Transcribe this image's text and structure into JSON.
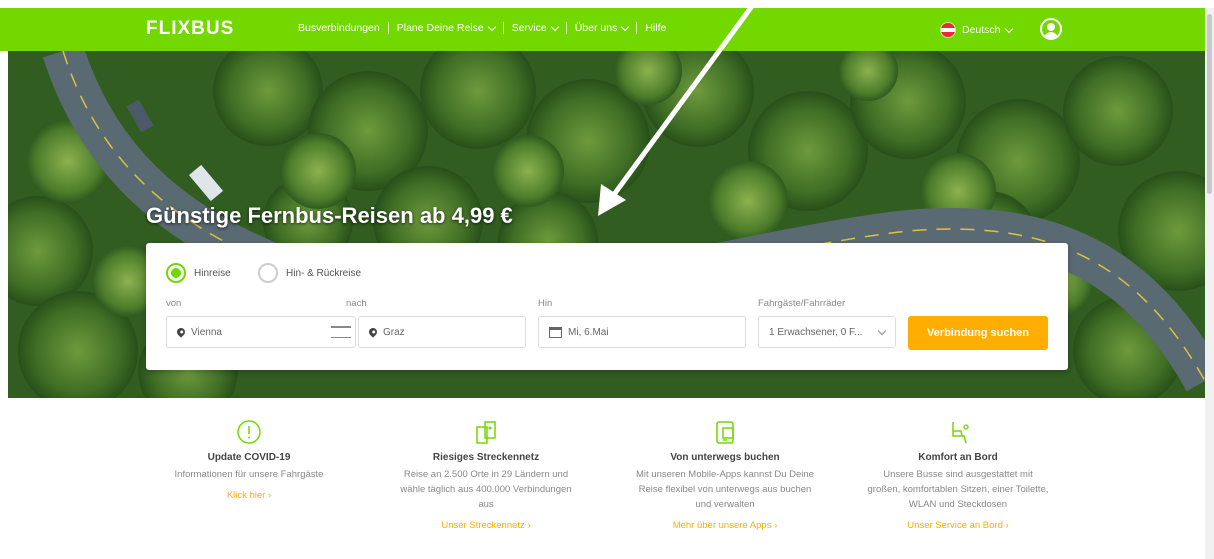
{
  "header": {
    "logo": "FLIXBUS",
    "nav": [
      {
        "label": "Busverbindungen",
        "has_dropdown": false
      },
      {
        "label": "Plane Deine Reise",
        "has_dropdown": true
      },
      {
        "label": "Service",
        "has_dropdown": true
      },
      {
        "label": "Über uns",
        "has_dropdown": true
      },
      {
        "label": "Hilfe",
        "has_dropdown": false
      }
    ],
    "language": "Deutsch"
  },
  "hero": {
    "headline": "Günstige Fernbus-Reisen ab 4,99 €"
  },
  "search": {
    "trip_types": [
      {
        "label": "Hinreise",
        "selected": true
      },
      {
        "label": "Hin- & Rückreise",
        "selected": false
      }
    ],
    "from_label": "von",
    "from_value": "Vienna",
    "to_label": "nach",
    "to_value": "Graz",
    "date_label": "Hin",
    "date_value": "Mi, 6.Mai",
    "passengers_label": "Fahrgäste/Fahrräder",
    "passengers_value": "1 Erwachsener, 0 F...",
    "submit_label": "Verbindung suchen"
  },
  "features": [
    {
      "icon": "info-circle-icon",
      "title": "Update COVID-19",
      "desc": "Informationen für unsere Fahrgäste",
      "link": "Klick hier"
    },
    {
      "icon": "route-network-icon",
      "title": "Riesiges Streckennetz",
      "desc": "Reise an 2.500 Orte in 29 Ländern und wähle täglich aus 400.000 Verbindungen aus",
      "link": "Unser Streckennetz"
    },
    {
      "icon": "mobile-app-icon",
      "title": "Von unterwegs buchen",
      "desc": "Mit unseren Mobile-Apps kannst Du Deine Reise flexibel von unterwegs aus buchen und verwalten",
      "link": "Mehr über unsere Apps"
    },
    {
      "icon": "seat-comfort-icon",
      "title": "Komfort an Bord",
      "desc": "Unsere Busse sind ausgestattet mit großen, komfortablen Sitzen, einer Toilette, WLAN und Steckdosen",
      "link": "Unser Service an Bord"
    }
  ],
  "colors": {
    "brand_green": "#73d700",
    "accent_orange": "#ffad00"
  }
}
